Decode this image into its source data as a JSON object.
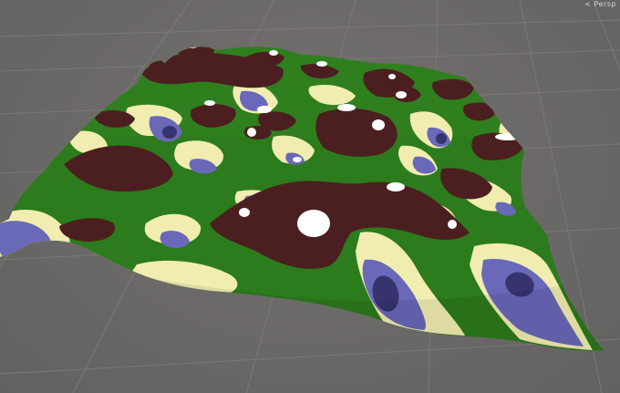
{
  "scene_view": {
    "projection_label": "< Persp"
  },
  "terrain": {
    "colors": {
      "deep_water": "#3b3b80",
      "shallow_water": "#6a6ab8",
      "sand": "#f3efb2",
      "grass": "#2f7f1e",
      "grass_dark": "#23651a",
      "rock": "#4b1f1f",
      "snow": "#ffffff"
    }
  },
  "grid": {
    "color": "#7c7a78"
  }
}
